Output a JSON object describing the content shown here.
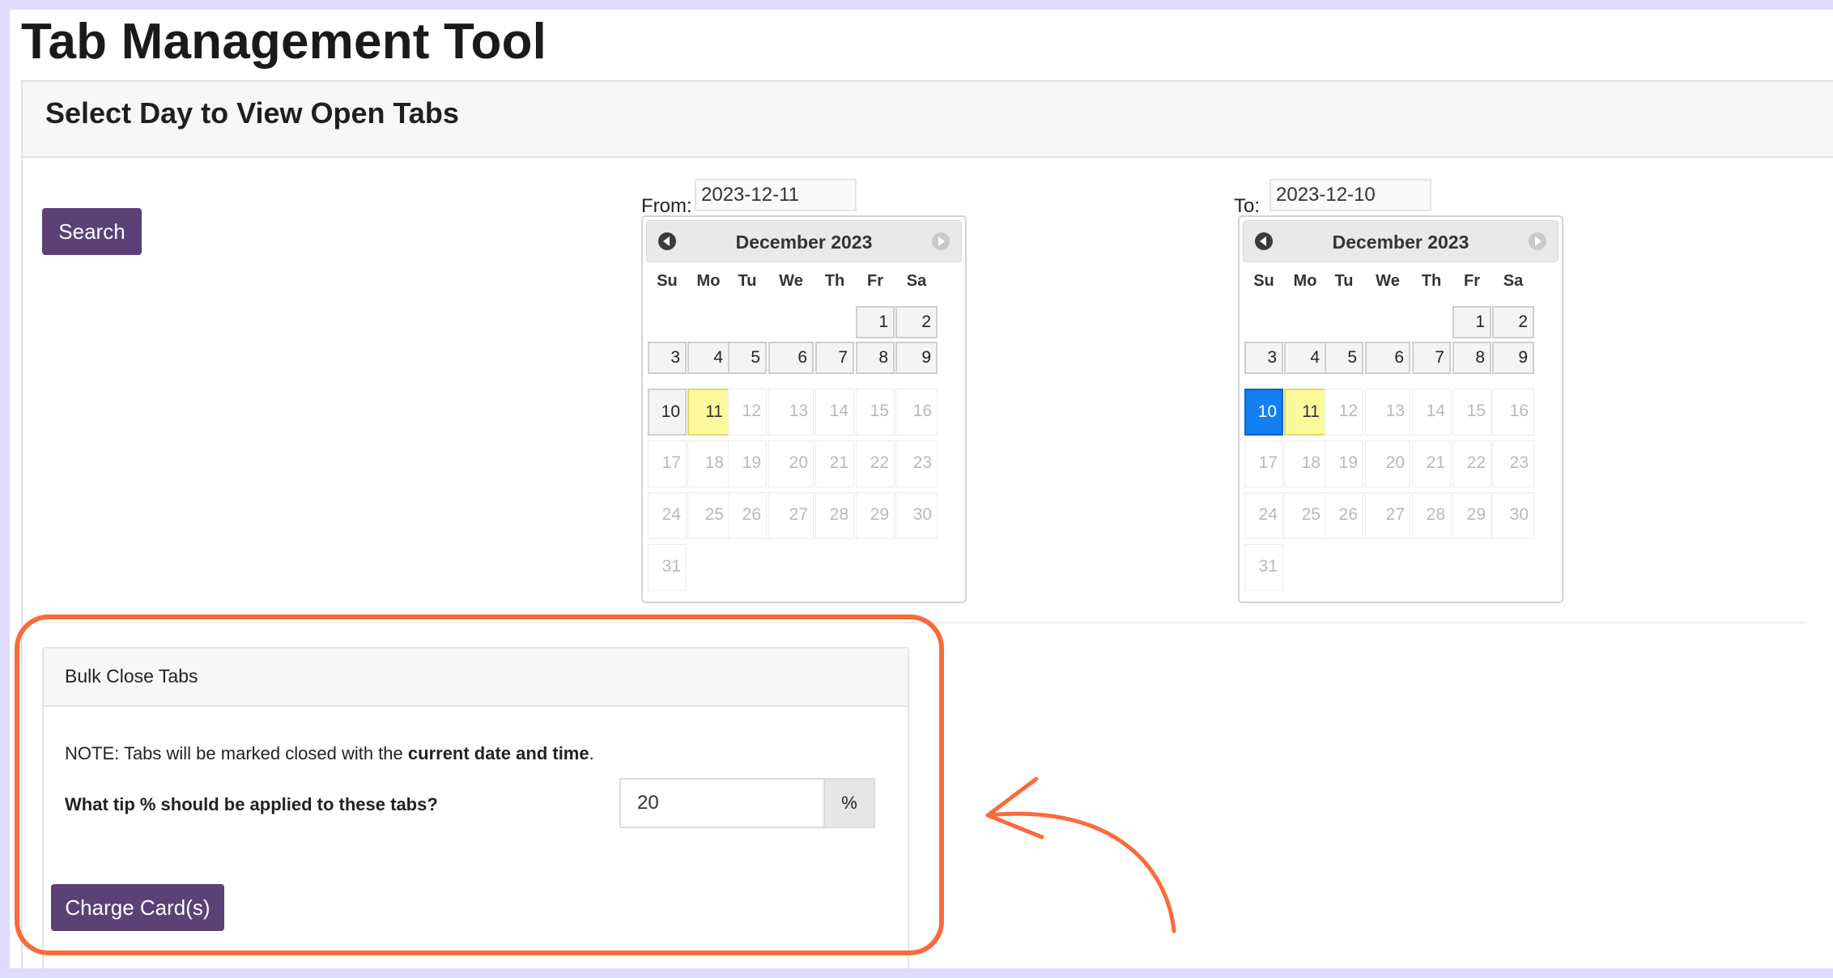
{
  "app": {
    "title": "Tab Management Tool"
  },
  "panel": {
    "title": "Select Day to View Open Tabs",
    "search_label": "Search"
  },
  "from": {
    "label": "From:",
    "value": "2023-12-11",
    "month_title": "December 2023"
  },
  "to": {
    "label": "To:",
    "value": "2023-12-10",
    "month_title": "December 2023"
  },
  "weekdays": [
    "Su",
    "Mo",
    "Tu",
    "We",
    "Th",
    "Fr",
    "Sa"
  ],
  "calendar": {
    "first_weekday_index": 5,
    "days_in_month": 31,
    "enabled_through": 11,
    "today": 11
  },
  "bulk_close": {
    "title": "Bulk Close Tabs",
    "note_prefix": "NOTE: Tabs will be marked closed with the ",
    "note_bold": "current date and time",
    "note_suffix": ".",
    "tip_question": "What tip % should be applied to these tabs?",
    "tip_value": "20",
    "tip_suffix": "%",
    "charge_label": "Charge Card(s)"
  },
  "colors": {
    "button": "#5b4176",
    "selected_day": "#127ff2",
    "today_day": "#fcf99b",
    "annotation": "#fa6b3c"
  },
  "icons": {
    "prev": "triangle-left-icon",
    "next": "triangle-right-icon"
  }
}
